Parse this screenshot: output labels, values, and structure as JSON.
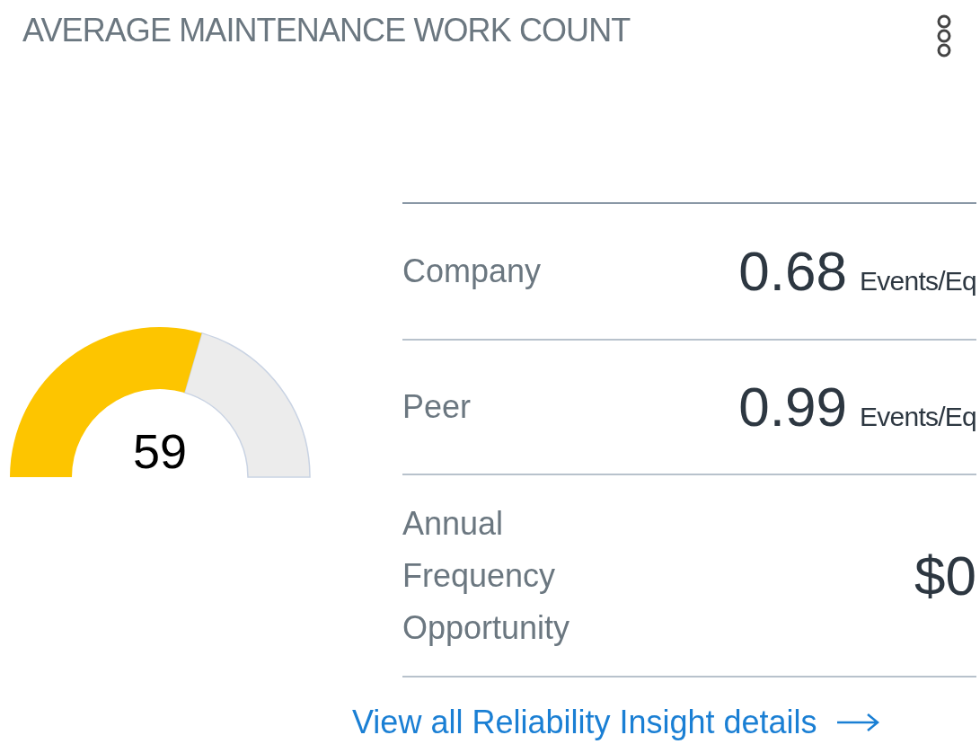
{
  "title": "AVERAGE MAINTENANCE WORK COUNT",
  "gauge": {
    "level": 0.59,
    "value": "59"
  },
  "metrics": [
    {
      "label": "Company",
      "value": "0.68",
      "unit": "Events/Eq"
    },
    {
      "label": "Peer",
      "value": "0.99",
      "unit": "Events/Eq"
    },
    {
      "label": "Annual Frequency Opportunity",
      "value": "$0"
    }
  ],
  "link": {
    "label": "View all Reliability Insight details"
  }
}
